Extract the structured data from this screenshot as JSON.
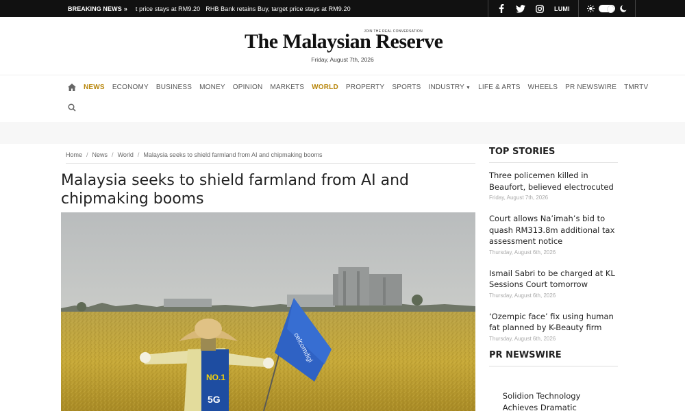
{
  "topbar": {
    "breaking_label": "BREAKING NEWS",
    "ticker": [
      "t price stays at RM9.20",
      "RHB Bank retains Buy, target price stays at RM9.20"
    ],
    "lumi_label": "LUMI"
  },
  "masthead": {
    "logo_text": "The Malaysian Reserve",
    "logo_tagline": "JOIN THE REAL CONVERSATION",
    "date": "Friday, August 7th, 2026"
  },
  "nav": {
    "items": [
      {
        "label": "NEWS",
        "active": true
      },
      {
        "label": "ECONOMY"
      },
      {
        "label": "BUSINESS"
      },
      {
        "label": "MONEY"
      },
      {
        "label": "OPINION"
      },
      {
        "label": "MARKETS"
      },
      {
        "label": "WORLD",
        "active": true
      },
      {
        "label": "PROPERTY"
      },
      {
        "label": "SPORTS"
      },
      {
        "label": "INDUSTRY",
        "dropdown": true
      },
      {
        "label": "LIFE & ARTS"
      },
      {
        "label": "WHEELS"
      },
      {
        "label": "PR NEWSWIRE"
      },
      {
        "label": "TMRTV"
      }
    ]
  },
  "breadcrumb": {
    "home": "Home",
    "news": "News",
    "world": "World",
    "current": "Malaysia seeks to shield farmland from AI and chipmaking booms"
  },
  "article": {
    "title": "Malaysia seeks to shield farmland from AI and chipmaking booms",
    "flag_text": "celcomdigi",
    "shirt_text": "NO.1",
    "shirt_5g": "5G"
  },
  "sidebar": {
    "top_stories_title": "TOP STORIES",
    "stories": [
      {
        "title": "Three policemen killed in Beaufort, believed electrocuted",
        "date": "Friday, August 7th, 2026"
      },
      {
        "title": "Court allows Na’imah’s bid to quash RM313.8m additional tax assessment notice",
        "date": "Thursday, August 6th, 2026"
      },
      {
        "title": "Ismail Sabri to be charged at KL Sessions Court tomorrow",
        "date": "Thursday, August 6th, 2026"
      },
      {
        "title": "‘Ozempic face’ fix using human fat planned by K-Beauty firm",
        "date": "Thursday, August 6th, 2026"
      }
    ],
    "pr_title": "PR NEWSWIRE",
    "pr_item": "Solidion Technology Achieves Dramatic Balance..."
  },
  "colors": {
    "accent": "#b8860b",
    "topbar_bg": "#111111"
  }
}
